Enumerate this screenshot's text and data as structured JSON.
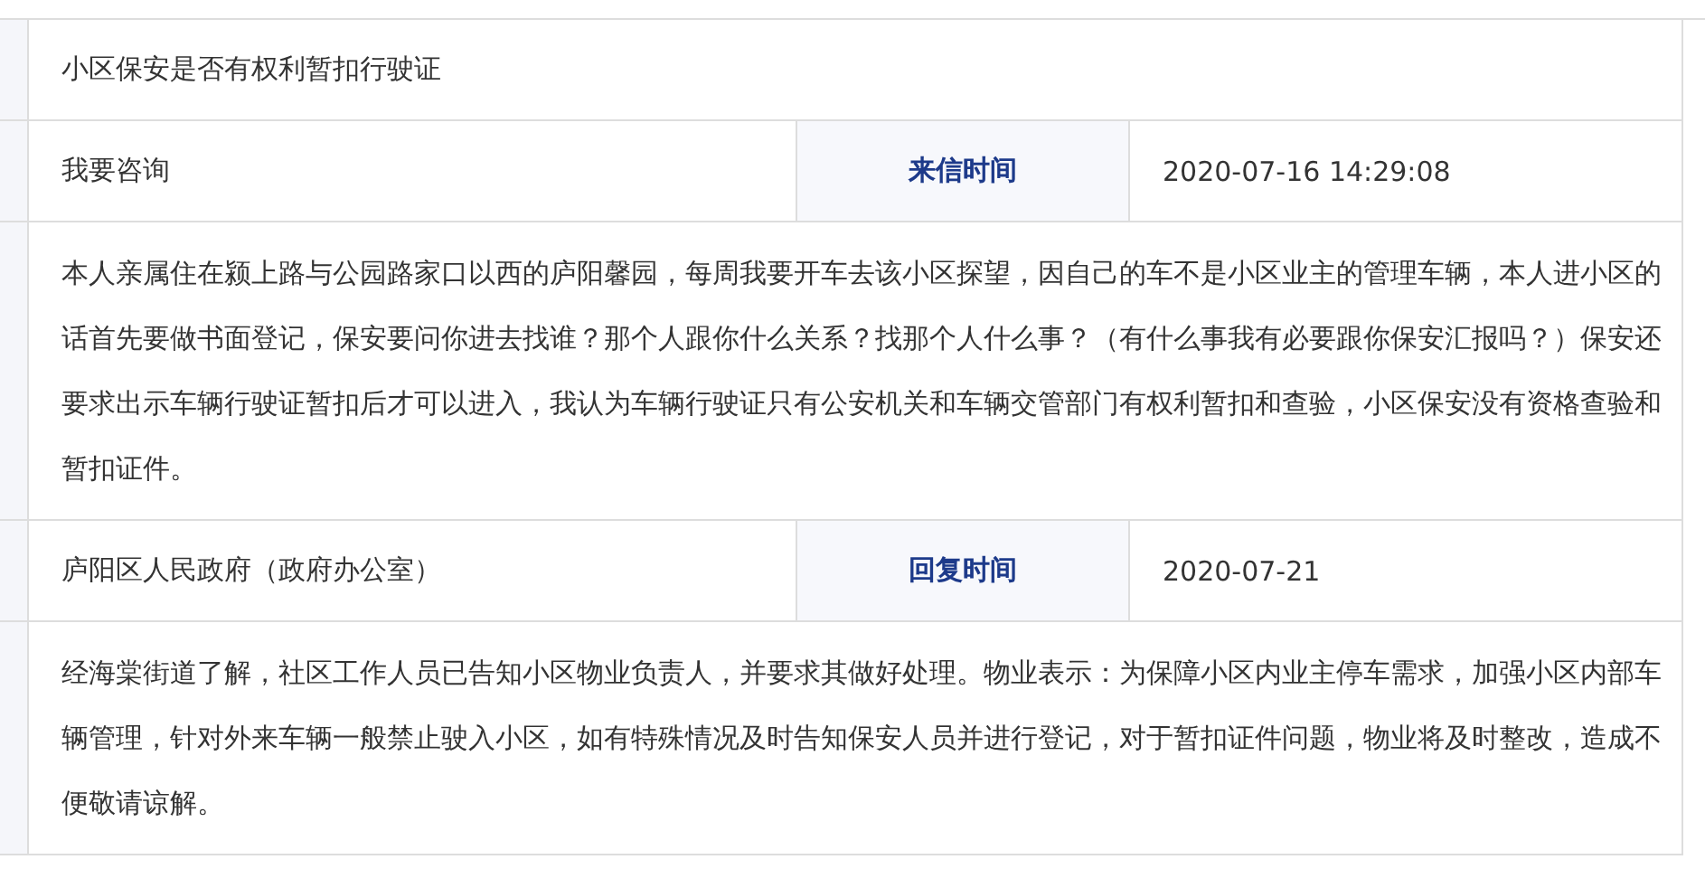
{
  "title": "小区保安是否有权利暂扣行驶证",
  "letter": {
    "type": "我要咨询",
    "time_label": "来信时间",
    "time": "2020-07-16 14:29:08"
  },
  "letter_body": "本人亲属住在颍上路与公园路家口以西的庐阳馨园，每周我要开车去该小区探望，因自己的车不是小区业主的管理车辆，本人进小区的话首先要做书面登记，保安要问你进去找谁？那个人跟你什么关系？找那个人什么事？（有什么事我有必要跟你保安汇报吗？）保安还要求出示车辆行驶证暂扣后才可以进入，我认为车辆行驶证只有公安机关和车辆交管部门有权利暂扣和查验，小区保安没有资格查验和暂扣证件。",
  "reply": {
    "department": "庐阳区人民政府（政府办公室）",
    "time_label": "回复时间",
    "time": "2020-07-21"
  },
  "reply_body": "经海棠街道了解，社区工作人员已告知小区物业负责人，并要求其做好处理。物业表示：为保障小区内业主停车需求，加强小区内部车辆管理，针对外来车辆一般禁止驶入小区，如有特殊情况及时告知保安人员并进行登记，对于暂扣证件问题，物业将及时整改，造成不便敬请谅解。"
}
